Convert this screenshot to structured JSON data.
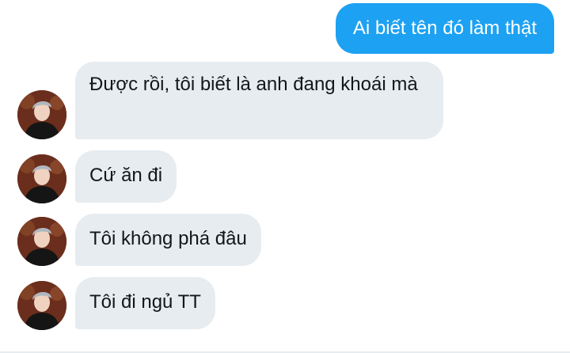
{
  "messages": [
    {
      "direction": "outgoing",
      "text": "Ai biết tên đó làm thật"
    },
    {
      "direction": "incoming",
      "text": "Được rồi, tôi biết là anh đang khoái mà"
    },
    {
      "direction": "incoming",
      "text": "Cứ ăn đi"
    },
    {
      "direction": "incoming",
      "text": "Tôi không phá đâu"
    },
    {
      "direction": "incoming",
      "text": "Tôi đi ngủ TT"
    }
  ],
  "colors": {
    "outgoing_bubble": "#1da1f2",
    "incoming_bubble": "#e6ecf0",
    "incoming_text": "#14171a",
    "avatar_background": "#5a2a1a"
  },
  "icons": {
    "avatar": "avatar-icon"
  }
}
